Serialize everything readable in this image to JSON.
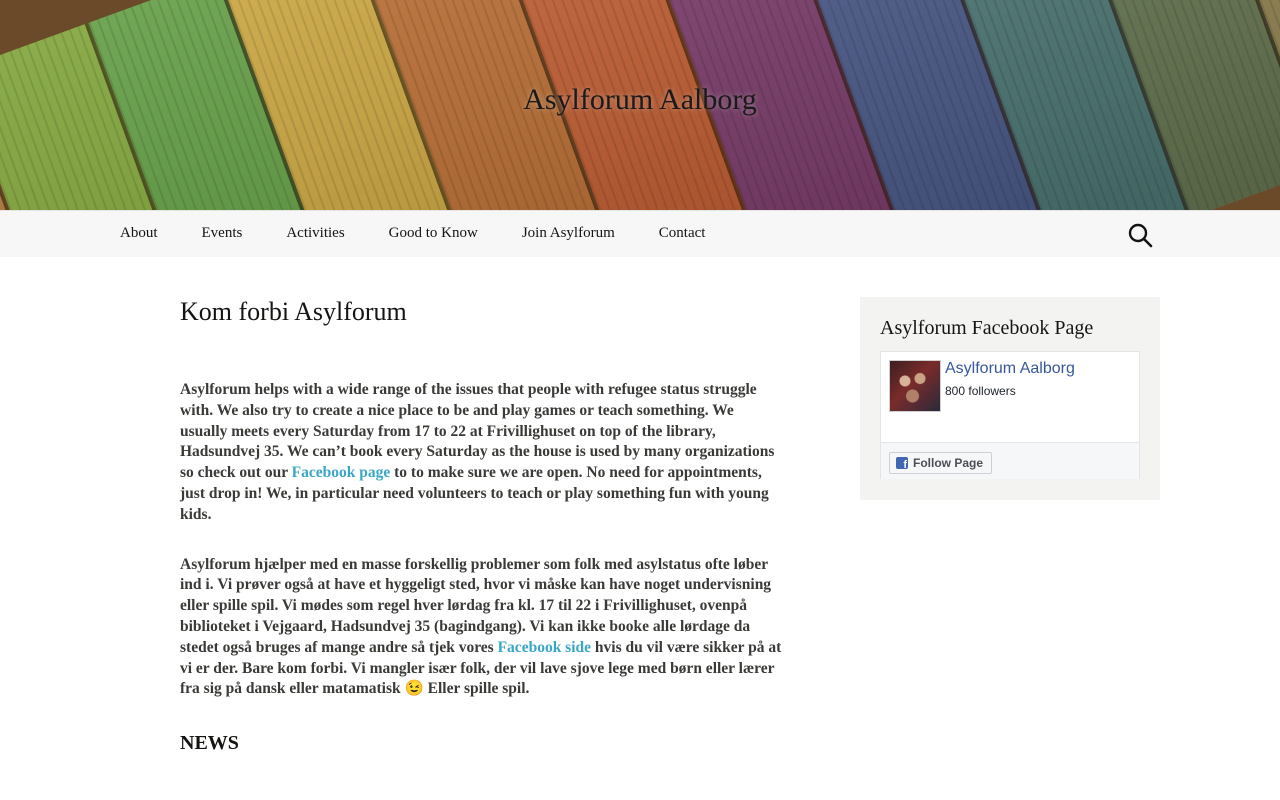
{
  "header": {
    "site_title": "Asylforum Aalborg",
    "plank_colors": [
      "#8b5a2b",
      "#a8722f",
      "#7ca133",
      "#5d9a3e",
      "#c9a33a",
      "#b86a2e",
      "#c05a2d",
      "#7b3a6a",
      "#4a5a8a",
      "#4f7a77",
      "#6a7b55",
      "#9a8a56",
      "#6b5040"
    ]
  },
  "nav": {
    "items": [
      {
        "label": "About"
      },
      {
        "label": "Events"
      },
      {
        "label": "Activities"
      },
      {
        "label": "Good to Know"
      },
      {
        "label": "Join Asylforum"
      },
      {
        "label": "Contact"
      }
    ],
    "search_icon": "search-icon"
  },
  "main": {
    "page_title": "Kom forbi Asylforum",
    "para_en_1": "Asylforum helps with a wide range of the issues that people with refugee status struggle with. We also try to create a nice place to be and play games or teach something. We usually meets every Saturday from 17 to 22 at Frivillighuset on top of the library, Hadsundvej 35. We can’t book every Saturday as the house is used by many organizations so check out our ",
    "para_en_link": "Facebook page",
    "para_en_2": " to to make sure we are open. No need for appointments, just drop in! We, in particular need volunteers to teach or play something fun with young kids.",
    "para_da_1": "Asylforum hjælper med en masse forskellig problemer som folk med asylstatus ofte løber ind i. Vi prøver også at have et hyggeligt sted, hvor vi måske kan have noget undervisning eller spille spil. Vi mødes som regel hver lørdag fra kl. 17 til 22 i Frivillighuset, ovenpå biblioteket i Vejgaard, Hadsundvej 35 (bagindgang). Vi kan ikke booke alle lørdage da stedet også bruges af mange andre så tjek vores ",
    "para_da_link": "Facebook side",
    "para_da_2": " hvis du vil være sikker på at vi er der. Bare kom forbi. Vi mangler især folk, der vil lave sjove lege med børn eller lærer fra sig på dansk eller matamatisk 😉 Eller spille spil.",
    "news_heading": "NEWS",
    "link_color": "#3aa8c4"
  },
  "sidebar": {
    "widget_title": "Asylforum Facebook Page",
    "fb_page_name": "Asylforum Aalborg",
    "fb_followers": "800 followers",
    "fb_follow_label": "Follow Page",
    "fb_brand_color": "#4267b2"
  }
}
